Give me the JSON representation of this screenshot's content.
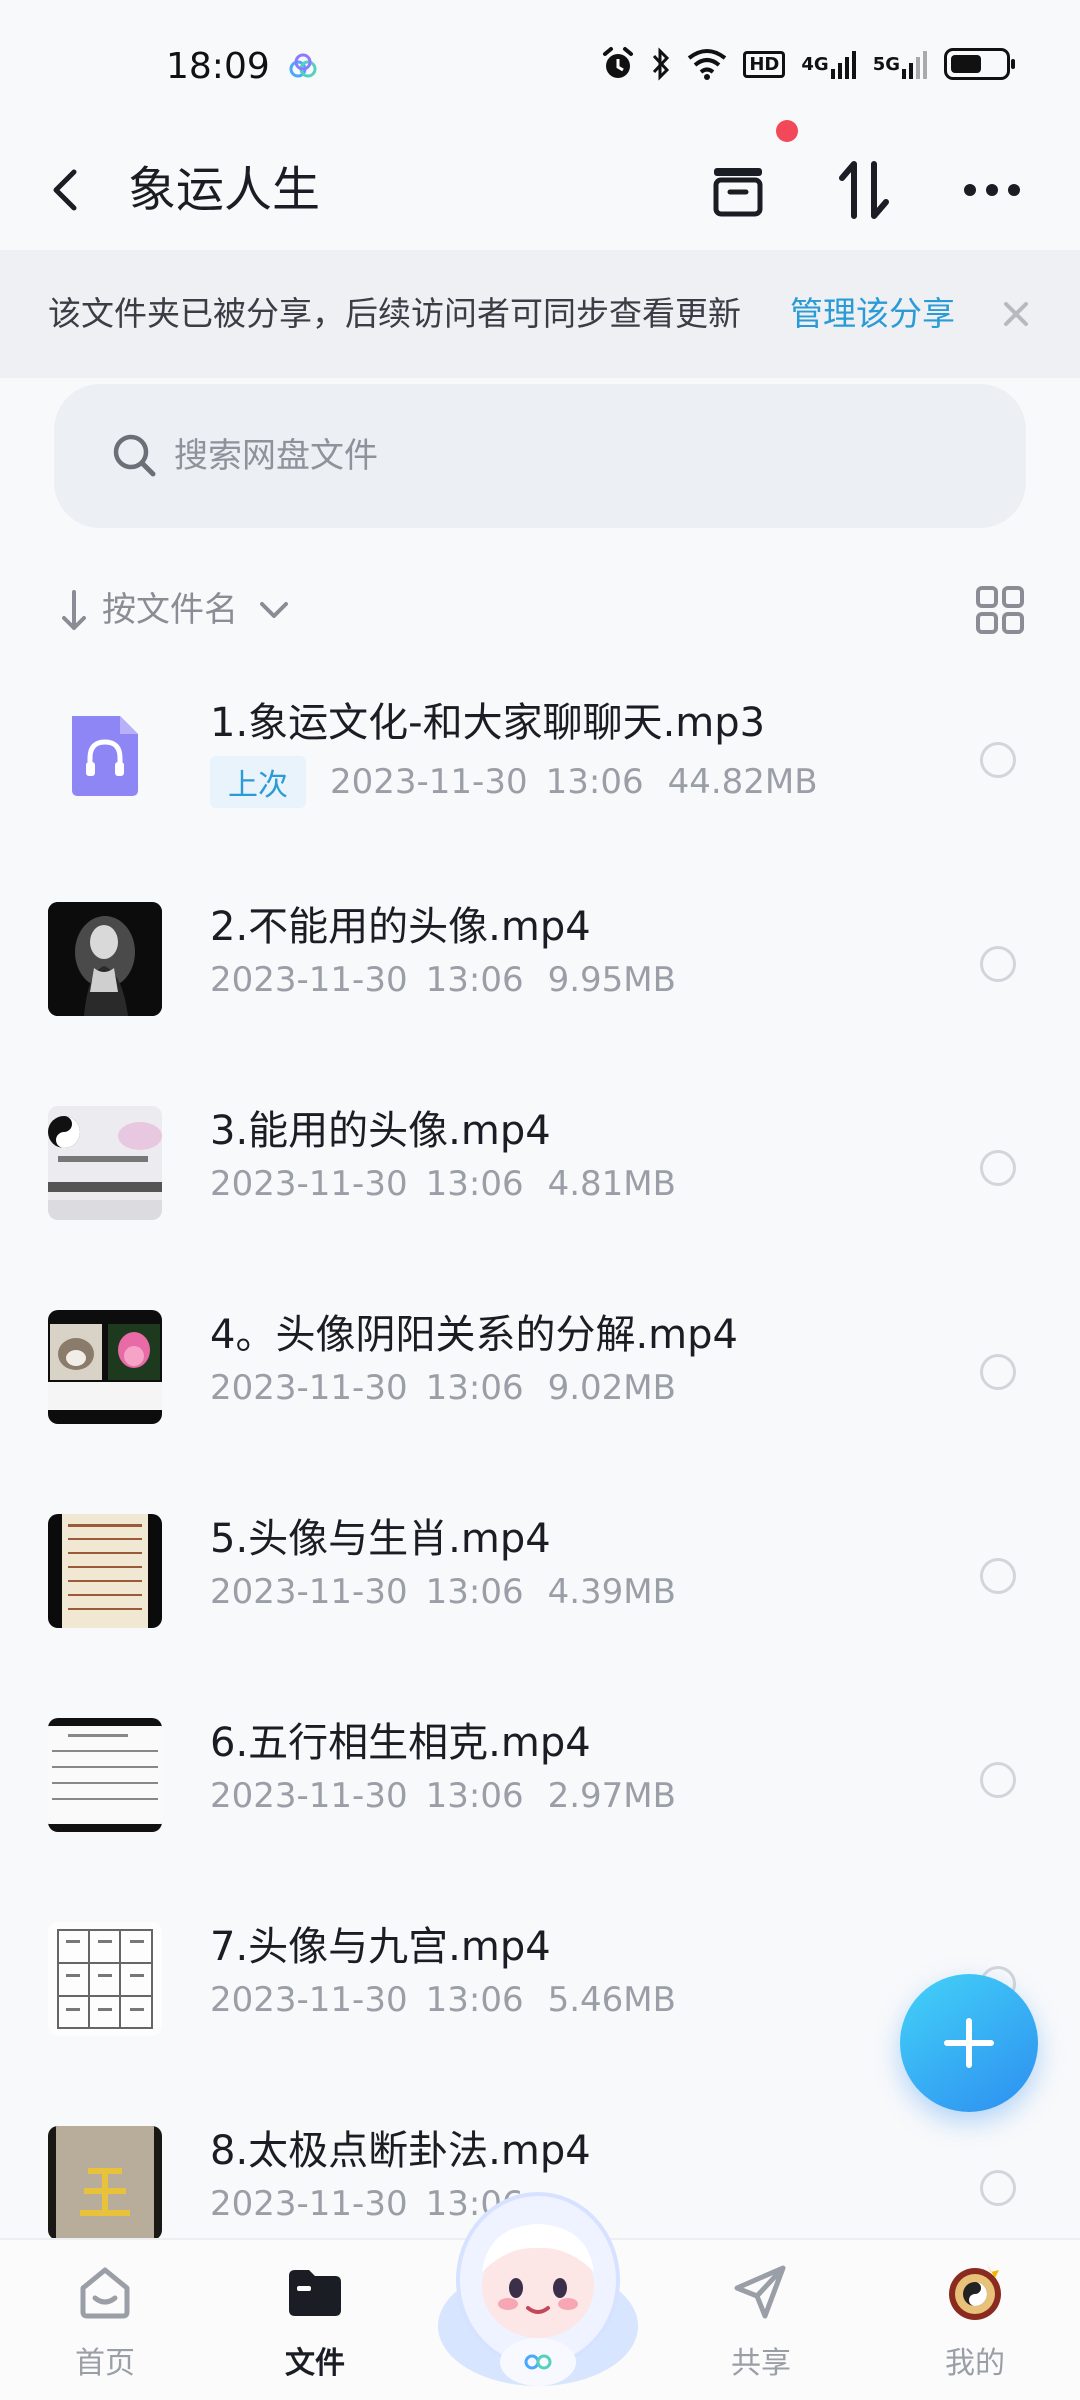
{
  "status_bar": {
    "time": "18:09",
    "hd_label": "HD",
    "net1": "4G",
    "net2": "5G",
    "battery_level": 0.55
  },
  "header": {
    "title": "象运人生"
  },
  "share_banner": {
    "text": "该文件夹已被分享，后续访问者可同步查看更新",
    "manage_label": "管理该分享"
  },
  "search": {
    "placeholder": "搜索网盘文件"
  },
  "sort": {
    "label": "按文件名"
  },
  "files": [
    {
      "name": "1.象运文化-和大家聊聊天.mp3",
      "tag": "上次",
      "date": "2023-11-30",
      "time": "13:06",
      "size": "44.82MB",
      "thumb": "audio-file-icon"
    },
    {
      "name": "2.不能用的头像.mp4",
      "date": "2023-11-30",
      "time": "13:06",
      "size": "9.95MB",
      "thumb": "portrait-video-thumb"
    },
    {
      "name": "3.能用的头像.mp4",
      "date": "2023-11-30",
      "time": "13:06",
      "size": "4.81MB",
      "thumb": "taiji-video-thumb"
    },
    {
      "name": "4。头像阴阳关系的分解.mp4",
      "date": "2023-11-30",
      "time": "13:06",
      "size": "9.02MB",
      "thumb": "cat-lotus-video-thumb"
    },
    {
      "name": "5.头像与生肖.mp4",
      "date": "2023-11-30",
      "time": "13:06",
      "size": "4.39MB",
      "thumb": "zodiac-table-video-thumb"
    },
    {
      "name": "6.五行相生相克.mp4",
      "date": "2023-11-30",
      "time": "13:06",
      "size": "2.97MB",
      "thumb": "wuxing-table-video-thumb"
    },
    {
      "name": "7.头像与九宫.mp4",
      "date": "2023-11-30",
      "time": "13:06",
      "size": "5.46MB",
      "thumb": "jiugong-grid-video-thumb"
    },
    {
      "name": "8.太极点断卦法.mp4",
      "date": "2023-11-30",
      "time": "13:06",
      "size": "",
      "thumb": "taiji-gua-video-thumb"
    }
  ],
  "bottom_nav": {
    "home": "首页",
    "files": "文件",
    "share": "共享",
    "mine": "我的"
  }
}
